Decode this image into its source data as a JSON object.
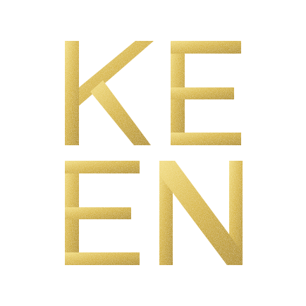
{
  "logo": {
    "text": "KEEN",
    "rows": [
      "KE",
      "EN"
    ],
    "colors": {
      "background": "#ffffff",
      "gold_light": "#f1dc82",
      "gold_mid": "#d4b13c",
      "gold_dark": "#a98417",
      "sparkle": "#fff4c2"
    }
  }
}
